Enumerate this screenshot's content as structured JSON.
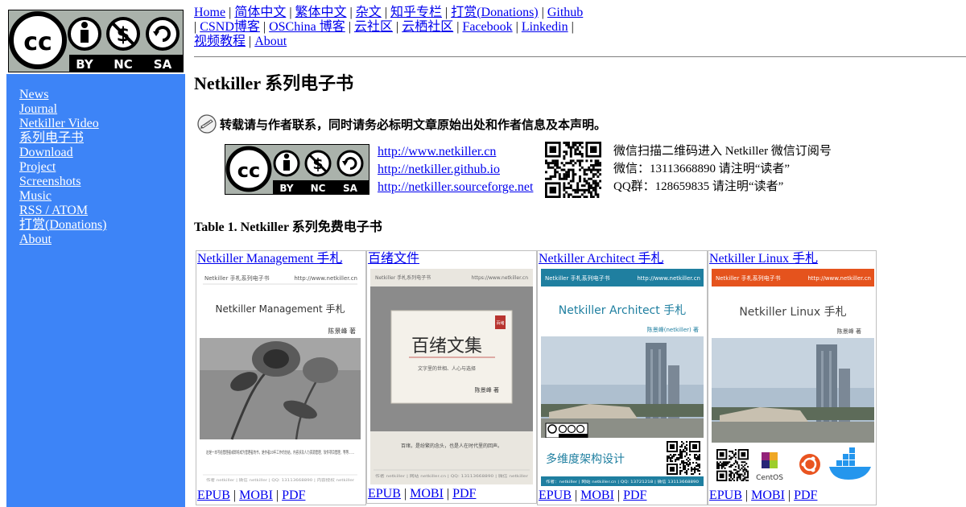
{
  "sidebar": {
    "logo_text": [
      "BY",
      "NC",
      "SA"
    ],
    "items": [
      {
        "label": "News"
      },
      {
        "label": "Journal"
      },
      {
        "label": "Netkiller Video"
      },
      {
        "label": "系列电子书"
      },
      {
        "label": "Download"
      },
      {
        "label": "Project"
      },
      {
        "label": "Screenshots"
      },
      {
        "label": "Music"
      },
      {
        "label": "RSS / ATOM"
      },
      {
        "label": "打赏(Donations)"
      },
      {
        "label": "About"
      }
    ]
  },
  "topnav": {
    "items": [
      "Home",
      "简体中文",
      "繁体中文",
      "杂文",
      "知乎专栏",
      "打赏(Donations)",
      "Github",
      "CSND博客",
      "OSChina 博客",
      "云社区",
      "云栖社区",
      "Facebook",
      "Linkedin",
      "视频教程",
      "About"
    ]
  },
  "page_title": "Netkiller 系列电子书",
  "notice": "转载请与作者联系，同时请务必标明文章原始出处和作者信息及本声明。",
  "links": [
    "http://www.netkiller.cn",
    "http://netkiller.github.io",
    "http://netkiller.sourceforge.net"
  ],
  "contact": {
    "line1": "微信扫描二维码进入 Netkiller 微信订阅号",
    "line2": "微信：13113668890 请注明“读者”",
    "line3": "QQ群：128659835 请注明“读者”"
  },
  "table_caption": "Table 1. Netkiller 系列免费电子书",
  "books": [
    {
      "title": "Netkiller Management 手札",
      "cover_header_left": "Netkiller 手札系列电子书",
      "cover_header_right": "http://www.netkiller.cn",
      "cover_title": "Netkiller Management 手札",
      "cover_author": "陈景峰 著",
      "cover_desc": "这是一本写给管理者或即将成为管理者的书，是作者20年工作的总结，内容涉及人力资源管理、软件项目管理、等等……",
      "cover_footer": "作者 netkiller | 微信 netkiller | QQ: 13113668890 | 内容授权 netkiller",
      "formats": [
        "EPUB",
        "MOBI",
        "PDF"
      ]
    },
    {
      "title": "百绪文件",
      "cover_header_left": "Netkiller 手札系列电子书",
      "cover_header_right": "https://www.netkiller.cn",
      "cover_title": "百绪文集",
      "cover_subtitle": "文字里的世相、人心与选择",
      "cover_author": "陈景峰 著",
      "cover_stamp": "百绪",
      "cover_desc": "百绪，是纷繁的念头，也是人在时代里的回声。",
      "cover_footer": "作者 netkiller | 网站 netkiller.cn | QQ: 13113668890 | 微信 netkiller",
      "formats": [
        "EPUB",
        "MOBI",
        "PDF"
      ]
    },
    {
      "title": "Netkiller Architect 手札",
      "cover_header_left": "Netkiller 手札系列电子书",
      "cover_header_right": "http://www.netkiller.cn",
      "cover_title": "Netkiller Architect 手札",
      "cover_author": "陈景峰(netkiller) 著",
      "cover_bottom_text": "多维度架构设计",
      "cover_footer": "作者：netkiller | 网站 netkiller.cn | QQ: 13721218 | 微信 13113668890",
      "formats": [
        "EPUB",
        "MOBI",
        "PDF"
      ]
    },
    {
      "title": "Netkiller Linux 手札",
      "cover_header_left": "Netkiller 手札系列电子书",
      "cover_header_right": "http://www.netkiller.cn",
      "cover_title": "Netkiller Linux 手札",
      "cover_author": "陈景峰 著",
      "cover_logo": "CentOS",
      "formats": [
        "EPUB",
        "MOBI",
        "PDF"
      ]
    }
  ],
  "colors": {
    "sidebar_bg": "#3d84f7",
    "link": "#0000ee",
    "architect_header": "#1f7fa0",
    "linux_header": "#e5531d"
  }
}
